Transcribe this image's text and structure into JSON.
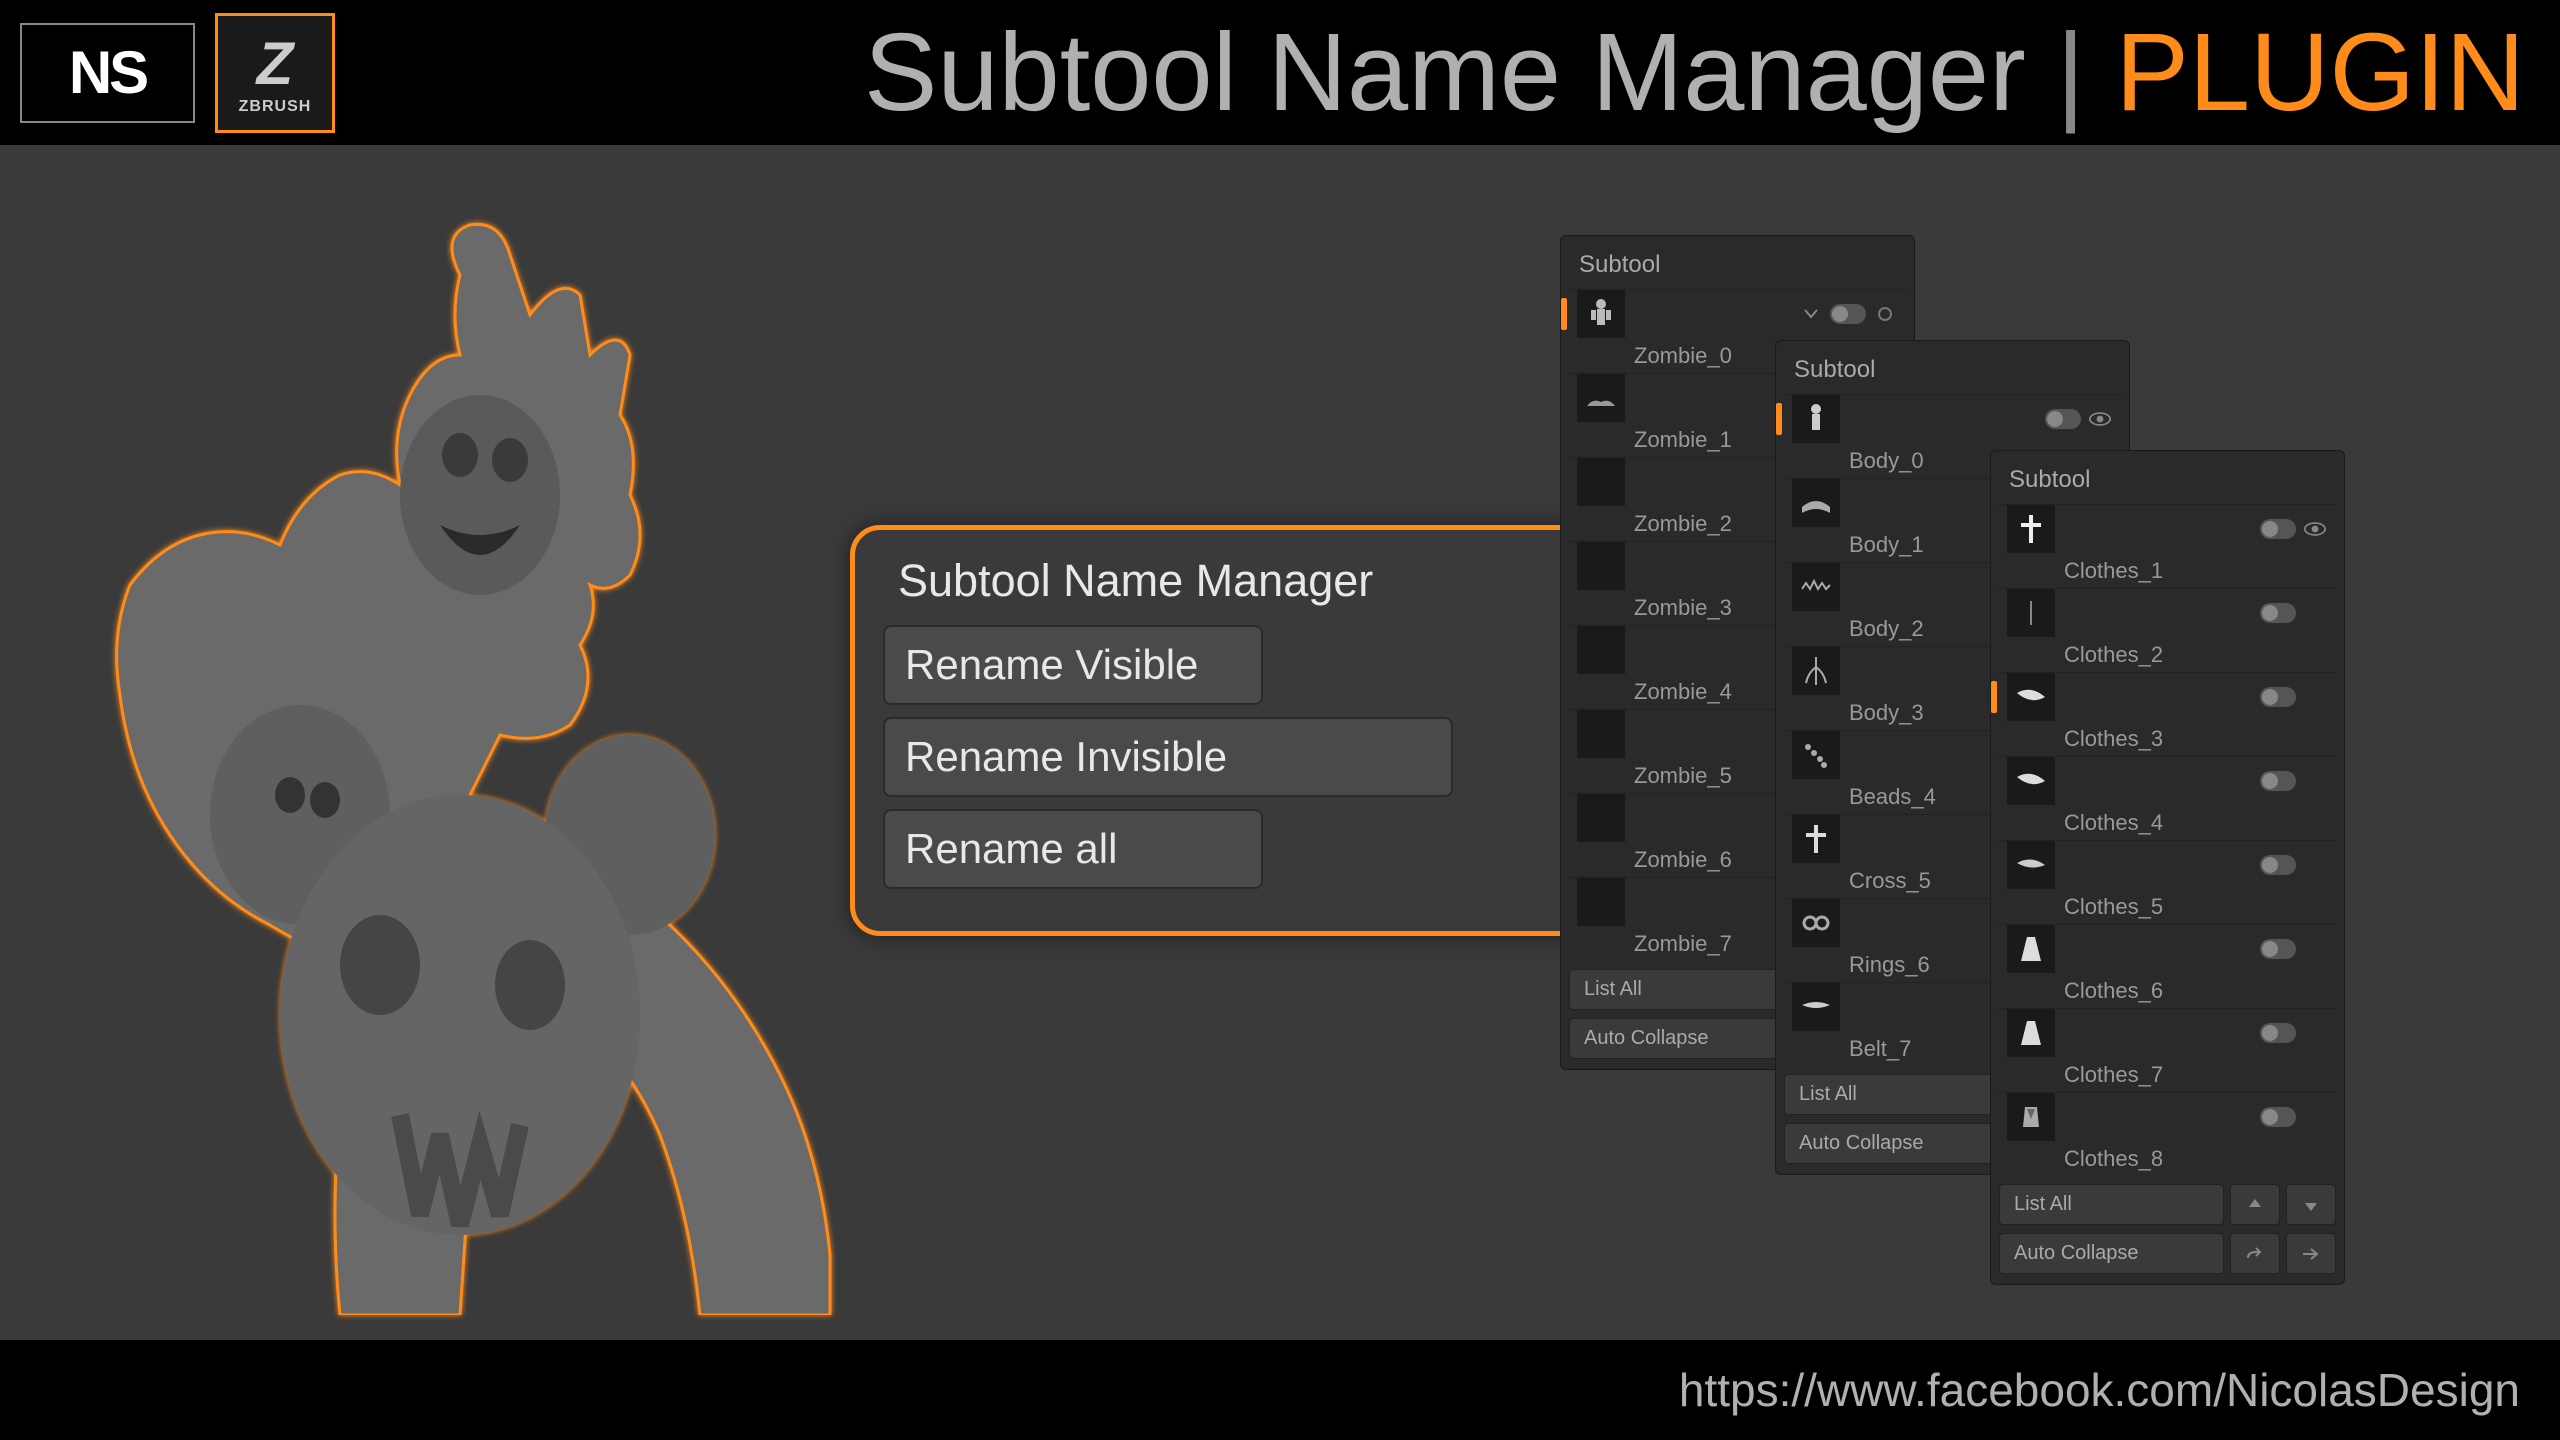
{
  "header": {
    "logo_ns": "NS",
    "zbrush_label": "ZBRUSH",
    "title_main": "Subtool Name Manager",
    "title_plugin": "PLUGIN"
  },
  "plugin": {
    "title": "Subtool Name Manager",
    "btn_visible": "Rename Visible",
    "btn_invisible": "Rename Invisible",
    "btn_all": "Rename all"
  },
  "panels": {
    "header": "Subtool",
    "list_all": "List All",
    "auto_collapse": "Auto Collapse",
    "p1_items": [
      "Zombie_0",
      "Zombie_1",
      "Zombie_2",
      "Zombie_3",
      "Zombie_4",
      "Zombie_5",
      "Zombie_6",
      "Zombie_7"
    ],
    "p2_items": [
      "Body_0",
      "Body_1",
      "Body_2",
      "Body_3",
      "Beads_4",
      "Cross_5",
      "Rings_6",
      "Belt_7"
    ],
    "p3_items": [
      "Clothes_1",
      "Clothes_2",
      "Clothes_3",
      "Clothes_4",
      "Clothes_5",
      "Clothes_6",
      "Clothes_7",
      "Clothes_8"
    ]
  },
  "footer": {
    "link": "https://www.facebook.com/NicolasDesign"
  },
  "colors": {
    "accent": "#ff8c1a",
    "bg": "#3a3a3a",
    "panel": "#2a2a2a"
  }
}
